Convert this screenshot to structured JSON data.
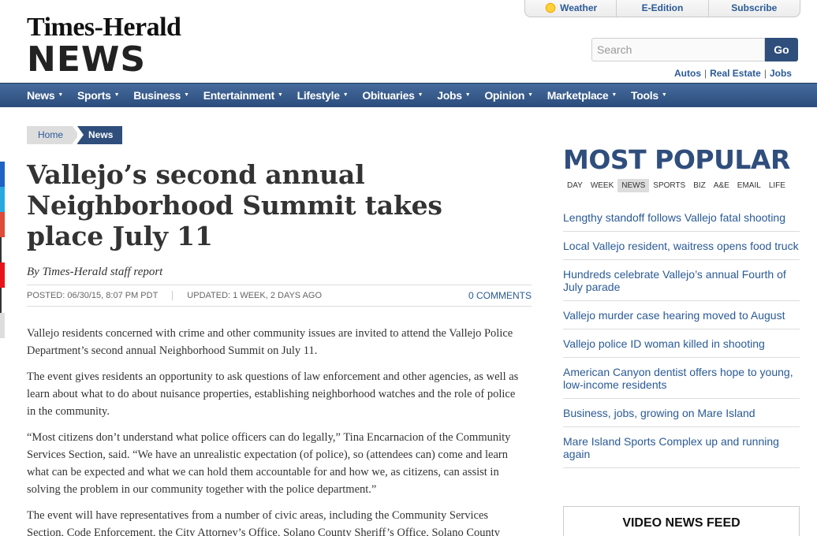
{
  "header": {
    "logo_line1": "Times-Herald",
    "logo_line2": "NEWS",
    "top_links": [
      "Weather",
      "E-Edition",
      "Subscribe"
    ],
    "search_placeholder": "Search",
    "go_label": "Go",
    "sub_links": [
      "Autos",
      "Real Estate",
      "Jobs"
    ]
  },
  "nav": {
    "items": [
      "News",
      "Sports",
      "Business",
      "Entertainment",
      "Lifestyle",
      "Obituaries",
      "Jobs",
      "Opinion",
      "Marketplace",
      "Tools"
    ]
  },
  "social_colors": [
    "#1f63c4",
    "#2aa8e0",
    "#dd4b39",
    "#ffffff",
    "#e8131a",
    "#ffffff",
    "#dddddd"
  ],
  "breadcrumb": {
    "home": "Home",
    "current": "News"
  },
  "article": {
    "headline": "Vallejo’s second annual Neighborhood Summit takes place July 11",
    "byline": "By Times-Herald staff report",
    "posted": "POSTED: 06/30/15, 8:07 PM PDT",
    "updated": "UPDATED: 1 WEEK, 2 DAYS AGO",
    "comments": "0 COMMENTS",
    "paragraphs": [
      "Vallejo residents concerned with crime and other community issues are invited to attend the Vallejo Police Department’s second annual Neighborhood Summit on July 11.",
      "The event gives residents an opportunity to ask questions of law enforcement and other agencies, as well as learn about what to do about nuisance properties, establishing neighborhood watches and the role of police in the community.",
      "“Most citizens don’t understand what police officers can do legally,” Tina Encarnacion of the Community Services Section, said. “We have an unrealistic expectation (of police), so (attendees can) come and learn what can be expected and what we can hold them accountable for and how we, as citizens, can assist in solving the problem in our community together with the police department.”",
      "The event will have representatives from a number of civic areas, including the Community Services Section, Code Enforcement, the City Attorney’s Office, Solano County Sheriff’s Office, Solano County"
    ]
  },
  "sidebar": {
    "title": "MOST POPULAR",
    "tabs": [
      "DAY",
      "WEEK",
      "NEWS",
      "SPORTS",
      "BIZ",
      "A&E",
      "EMAIL",
      "LIFE"
    ],
    "active_tab": "NEWS",
    "items": [
      "Lengthy standoff follows Vallejo fatal shooting",
      "Local Vallejo resident, waitress opens food truck",
      "Hundreds celebrate Vallejo’s annual Fourth of July parade",
      "Vallejo murder case hearing moved to August",
      "Vallejo police ID woman killed in shooting",
      "American Canyon dentist offers hope to young, low-income residents",
      "Business, jobs, growing on Mare Island",
      "Mare Island Sports Complex up and running again"
    ],
    "video_feed": "VIDEO NEWS FEED"
  }
}
